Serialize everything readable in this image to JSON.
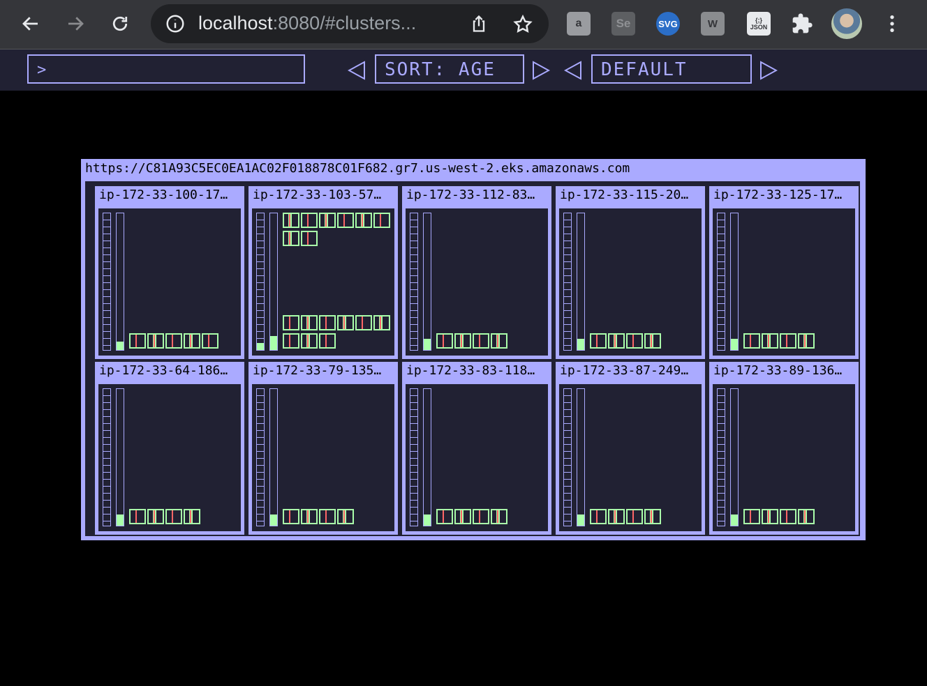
{
  "browser": {
    "host": "localhost",
    "path": ":8080/#clusters..."
  },
  "toolbar": {
    "command_prompt": ">",
    "sort_label": "SORT: AGE",
    "theme_label": "DEFAULT"
  },
  "cluster": {
    "url": "https://C81A93C5EC0EA1AC02F018878C01F682.gr7.us-west-2.eks.amazonaws.com",
    "colors": {
      "frame": "#aaaaff",
      "background": "#212133",
      "pod": "#aaffaa",
      "pod_marker": "#ff6666"
    },
    "nodes": [
      {
        "name": "ip-172-33-100-17…",
        "cpu_usage": 0.0,
        "memory_usage": 0.06,
        "pod_rows": [
          {
            "from": "bottom",
            "count": 5
          }
        ]
      },
      {
        "name": "ip-172-33-103-57…",
        "cpu_usage": 0.05,
        "memory_usage": 0.1,
        "pod_rows": [
          {
            "from": "top",
            "count": 6
          },
          {
            "from": "top",
            "count": 2
          },
          {
            "from": "bottom",
            "count": 3
          },
          {
            "from": "bottom",
            "count": 6
          }
        ]
      },
      {
        "name": "ip-172-33-112-83…",
        "cpu_usage": 0.0,
        "memory_usage": 0.08,
        "pod_rows": [
          {
            "from": "bottom",
            "count": 4
          }
        ]
      },
      {
        "name": "ip-172-33-115-20…",
        "cpu_usage": 0.0,
        "memory_usage": 0.08,
        "pod_rows": [
          {
            "from": "bottom",
            "count": 4
          }
        ]
      },
      {
        "name": "ip-172-33-125-17…",
        "cpu_usage": 0.0,
        "memory_usage": 0.08,
        "pod_rows": [
          {
            "from": "bottom",
            "count": 4
          }
        ]
      },
      {
        "name": "ip-172-33-64-186…",
        "cpu_usage": 0.0,
        "memory_usage": 0.08,
        "pod_rows": [
          {
            "from": "bottom",
            "count": 4
          }
        ]
      },
      {
        "name": "ip-172-33-79-135…",
        "cpu_usage": 0.0,
        "memory_usage": 0.08,
        "pod_rows": [
          {
            "from": "bottom",
            "count": 4
          }
        ]
      },
      {
        "name": "ip-172-33-83-118…",
        "cpu_usage": 0.0,
        "memory_usage": 0.08,
        "pod_rows": [
          {
            "from": "bottom",
            "count": 4
          }
        ]
      },
      {
        "name": "ip-172-33-87-249…",
        "cpu_usage": 0.0,
        "memory_usage": 0.08,
        "pod_rows": [
          {
            "from": "bottom",
            "count": 4
          }
        ]
      },
      {
        "name": "ip-172-33-89-136…",
        "cpu_usage": 0.0,
        "memory_usage": 0.08,
        "pod_rows": [
          {
            "from": "bottom",
            "count": 4
          }
        ]
      }
    ]
  }
}
